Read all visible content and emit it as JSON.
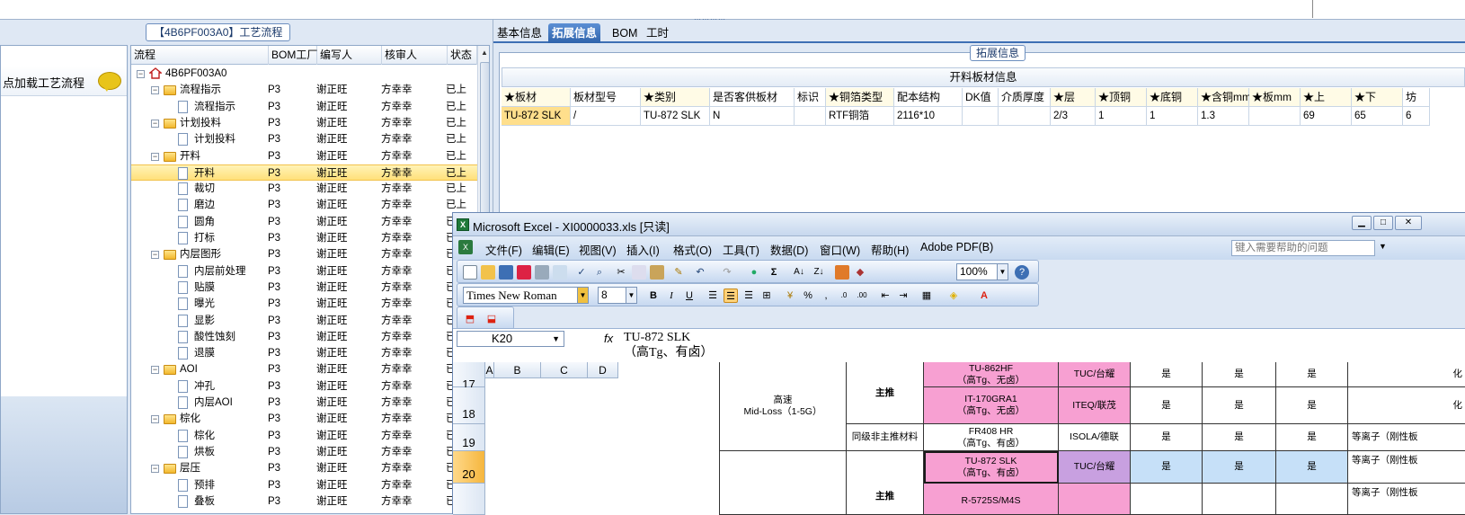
{
  "top": {
    "grip": "⋯⋯⋯⋯"
  },
  "left": {
    "flow_title": "【4B6PF003A0】工艺流程",
    "load_label": "点加载工艺流程",
    "columns": [
      "流程",
      "BOM工厂",
      "编写人",
      "核审人",
      "状态"
    ],
    "rows": [
      {
        "name": "4B6PF003A0",
        "kind": "root",
        "level": 0,
        "bom": "",
        "writer": "",
        "reviewer": "",
        "status": ""
      },
      {
        "name": "流程指示",
        "kind": "folder",
        "level": 1,
        "bom": "P3",
        "writer": "谢正旺",
        "reviewer": "方幸幸",
        "status": "已上"
      },
      {
        "name": "流程指示",
        "kind": "doc",
        "level": 2,
        "bom": "P3",
        "writer": "谢正旺",
        "reviewer": "方幸幸",
        "status": "已上"
      },
      {
        "name": "计划投料",
        "kind": "folder",
        "level": 1,
        "bom": "P3",
        "writer": "谢正旺",
        "reviewer": "方幸幸",
        "status": "已上"
      },
      {
        "name": "计划投料",
        "kind": "doc",
        "level": 2,
        "bom": "P3",
        "writer": "谢正旺",
        "reviewer": "方幸幸",
        "status": "已上"
      },
      {
        "name": "开料",
        "kind": "folder",
        "level": 1,
        "bom": "P3",
        "writer": "谢正旺",
        "reviewer": "方幸幸",
        "status": "已上"
      },
      {
        "name": "开料",
        "kind": "doc",
        "level": 2,
        "bom": "P3",
        "writer": "谢正旺",
        "reviewer": "方幸幸",
        "status": "已上",
        "selected": true
      },
      {
        "name": "裁切",
        "kind": "doc",
        "level": 2,
        "bom": "P3",
        "writer": "谢正旺",
        "reviewer": "方幸幸",
        "status": "已上"
      },
      {
        "name": "磨边",
        "kind": "doc",
        "level": 2,
        "bom": "P3",
        "writer": "谢正旺",
        "reviewer": "方幸幸",
        "status": "已上"
      },
      {
        "name": "圆角",
        "kind": "doc",
        "level": 2,
        "bom": "P3",
        "writer": "谢正旺",
        "reviewer": "方幸幸",
        "status": "已上"
      },
      {
        "name": "打标",
        "kind": "doc",
        "level": 2,
        "bom": "P3",
        "writer": "谢正旺",
        "reviewer": "方幸幸",
        "status": "已上"
      },
      {
        "name": "内层图形",
        "kind": "folder",
        "level": 1,
        "bom": "P3",
        "writer": "谢正旺",
        "reviewer": "方幸幸",
        "status": "已上"
      },
      {
        "name": "内层前处理",
        "kind": "doc",
        "level": 2,
        "bom": "P3",
        "writer": "谢正旺",
        "reviewer": "方幸幸",
        "status": "已上"
      },
      {
        "name": "贴膜",
        "kind": "doc",
        "level": 2,
        "bom": "P3",
        "writer": "谢正旺",
        "reviewer": "方幸幸",
        "status": "已上"
      },
      {
        "name": "曝光",
        "kind": "doc",
        "level": 2,
        "bom": "P3",
        "writer": "谢正旺",
        "reviewer": "方幸幸",
        "status": "已上"
      },
      {
        "name": "显影",
        "kind": "doc",
        "level": 2,
        "bom": "P3",
        "writer": "谢正旺",
        "reviewer": "方幸幸",
        "status": "已上"
      },
      {
        "name": "酸性蚀刻",
        "kind": "doc",
        "level": 2,
        "bom": "P3",
        "writer": "谢正旺",
        "reviewer": "方幸幸",
        "status": "已上"
      },
      {
        "name": "退膜",
        "kind": "doc",
        "level": 2,
        "bom": "P3",
        "writer": "谢正旺",
        "reviewer": "方幸幸",
        "status": "已上"
      },
      {
        "name": "AOI",
        "kind": "folder",
        "level": 1,
        "bom": "P3",
        "writer": "谢正旺",
        "reviewer": "方幸幸",
        "status": "已上"
      },
      {
        "name": "冲孔",
        "kind": "doc",
        "level": 2,
        "bom": "P3",
        "writer": "谢正旺",
        "reviewer": "方幸幸",
        "status": "已上"
      },
      {
        "name": "内层AOI",
        "kind": "doc",
        "level": 2,
        "bom": "P3",
        "writer": "谢正旺",
        "reviewer": "方幸幸",
        "status": "已上"
      },
      {
        "name": "棕化",
        "kind": "folder",
        "level": 1,
        "bom": "P3",
        "writer": "谢正旺",
        "reviewer": "方幸幸",
        "status": "已上"
      },
      {
        "name": "棕化",
        "kind": "doc",
        "level": 2,
        "bom": "P3",
        "writer": "谢正旺",
        "reviewer": "方幸幸",
        "status": "已上"
      },
      {
        "name": "烘板",
        "kind": "doc",
        "level": 2,
        "bom": "P3",
        "writer": "谢正旺",
        "reviewer": "方幸幸",
        "status": "已上"
      },
      {
        "name": "层压",
        "kind": "folder",
        "level": 1,
        "bom": "P3",
        "writer": "谢正旺",
        "reviewer": "方幸幸",
        "status": "已上"
      },
      {
        "name": "预排",
        "kind": "doc",
        "level": 2,
        "bom": "P3",
        "writer": "谢正旺",
        "reviewer": "方幸幸",
        "status": "已上"
      },
      {
        "name": "叠板",
        "kind": "doc",
        "level": 2,
        "bom": "P3",
        "writer": "谢正旺",
        "reviewer": "方幸幸",
        "status": "已上"
      }
    ]
  },
  "right": {
    "tabs": [
      "基本信息",
      "拓展信息",
      "BOM",
      "工时"
    ],
    "active_tab": 1,
    "ext_title": "拓展信息",
    "table_title": "开料板材信息",
    "columns": [
      "★板材",
      "板材型号",
      "★类别",
      "是否客供板材",
      "标识",
      "★铜箔类型",
      "配本结构",
      "DK值",
      "介质厚度",
      "★层",
      "★顶铜",
      "★底铜",
      "★含铜mm",
      "★板mm",
      "★上",
      "★下",
      "坊"
    ],
    "row": [
      "TU-872 SLK",
      "/",
      "TU-872 SLK",
      "N",
      "",
      "RTF铜箔",
      "2116*10",
      "",
      "",
      "2/3",
      "1",
      "1",
      "1.3",
      "",
      "69",
      "65",
      "6"
    ]
  },
  "excel": {
    "title": "Microsoft Excel - XI0000033.xls  [只读]",
    "menu": [
      "文件(F)",
      "编辑(E)",
      "视图(V)",
      "插入(I)",
      "格式(O)",
      "工具(T)",
      "数据(D)",
      "窗口(W)",
      "帮助(H)",
      "Adobe PDF(B)"
    ],
    "help_placeholder": "键入需要帮助的问题",
    "zoom": "100%",
    "font_name": "Times New Roman",
    "font_size": "8",
    "name_box": "K20",
    "formula": "TU-872 SLK\n（高Tg、有卤）",
    "col_headers": [
      "A",
      "B",
      "C",
      "D"
    ],
    "row_headers": [
      "17",
      "18",
      "19",
      "20"
    ],
    "cells": {
      "speed": "高速\nMid-Loss（1-5G）",
      "main1": "主推",
      "main2": "主推",
      "same_level": "同级非主推材料",
      "m17": "TU-862HF\n（高Tg、无卤）",
      "m18": "IT-170GRA1\n（高Tg、无卤）",
      "m19": "FR408 HR\n（高Tg、有卤）",
      "m20": "TU-872 SLK\n（高Tg、有卤）",
      "m21": "R-5725S/M4S",
      "s17": "TUC/台耀",
      "s18": "ITEQ/联茂",
      "s19": "ISOLA/德联",
      "s20": "TUC/台耀",
      "yes": "是",
      "c17": "化",
      "c18": "化",
      "c19": "等离子（刚性板",
      "c20": "等离子（刚性板",
      "c21": "等离子（刚性板"
    }
  }
}
